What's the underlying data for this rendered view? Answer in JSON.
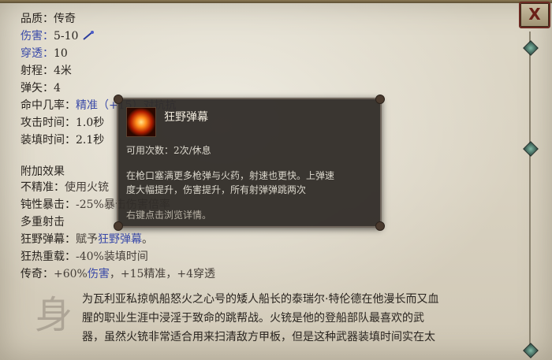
{
  "close_label": "X",
  "stats": {
    "quality": {
      "label": "品质：",
      "value": "传奇"
    },
    "damage": {
      "label": "伤害：",
      "value": "5-10"
    },
    "penetration": {
      "label": "穿透：",
      "value": "10"
    },
    "range": {
      "label": "射程：",
      "value": "4米"
    },
    "ammo": {
      "label": "弹矢：",
      "value": "4"
    },
    "accuracy": {
      "label": "命中几率：",
      "value": "精准（+15）对抗抗"
    },
    "attack_time": {
      "label": "攻击时间：",
      "value": "1.0秒"
    },
    "reload_time": {
      "label": "装填时间：",
      "value": "2.1秒"
    }
  },
  "effects": {
    "heading": "附加效果",
    "imprecise": {
      "label": "不精准：",
      "value": "使用火铳"
    },
    "dull_crit": {
      "label": "钝性暴击：",
      "value": "-25%暴击伤害倍率"
    },
    "multi_shot": {
      "label": "多重射击"
    },
    "wild_barrage": {
      "label": "狂野弹幕：",
      "prefix": "赋予",
      "link": "狂野弹幕",
      "suffix": "。"
    },
    "heavy_load": {
      "label": "狂热重载：",
      "value": "-40%装填时间"
    },
    "legend": {
      "label": "传奇：",
      "p1": "+60%",
      "link": "伤害",
      "p2": "，+15精准，+4穿透"
    }
  },
  "tooltip": {
    "title": "狂野弹幕",
    "uses": "可用次数：2次/休息",
    "desc1": "在枪口塞满更多枪弹与火药，射速也更快。上弹速",
    "desc2": "度大幅提升，伤害提升，所有射弹弹跳两次",
    "hint": "右键点击浏览详情。"
  },
  "bio": {
    "glyph": "身",
    "line1": "为瓦利亚私掠帆船怒火之心号的矮人船长的泰瑞尔·特伦德在他漫长而又血",
    "line2": "腥的职业生涯中浸淫于致命的跳帮战。火铳是他的登船部队最喜欢的武",
    "line3": "器，虽然火铳非常适合用来扫清敌方甲板，但是这种武器装填时间实在太"
  }
}
